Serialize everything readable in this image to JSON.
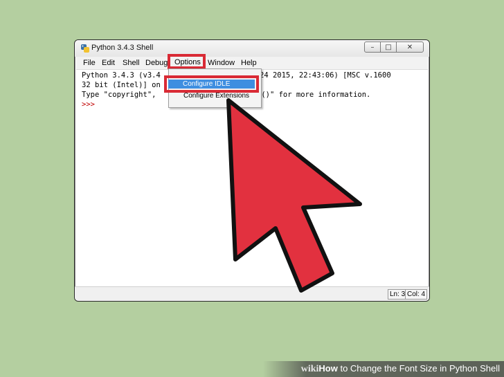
{
  "window": {
    "title": "Python 3.4.3 Shell",
    "buttons": {
      "minimize": "–",
      "maximize": "□",
      "close": "✕"
    }
  },
  "menubar": {
    "file": "File",
    "edit": "Edit",
    "shell": "Shell",
    "debug": "Debug",
    "options": "Options",
    "window": "Window",
    "help": "Help"
  },
  "shell": {
    "line1_start": "Python 3.4.3 (v3.4",
    "line1_end": "24 2015, 22:43:06) [MSC v.1600",
    "line2_start": "32 bit (Intel)] on",
    "line3_start": "Type \"copyright\",",
    "line3_end": "e()\" for more information.",
    "prompt": ">>>"
  },
  "dropdown": {
    "item1": "Configure IDLE",
    "item2": "Configure Extensions"
  },
  "status": {
    "line": "Ln: 3",
    "col": "Col: 4"
  },
  "footer": {
    "wiki": "wiki",
    "how": "How",
    "rest": " to Change the Font Size in Python Shell"
  },
  "colors": {
    "highlight_red": "#d92a35",
    "cursor_red": "#e2313f",
    "selection_blue": "#3e8ee0",
    "background_green": "#b4cfa0"
  },
  "icons": [
    "python-icon",
    "minimize-icon",
    "maximize-icon",
    "close-icon",
    "cursor-arrow-icon"
  ]
}
